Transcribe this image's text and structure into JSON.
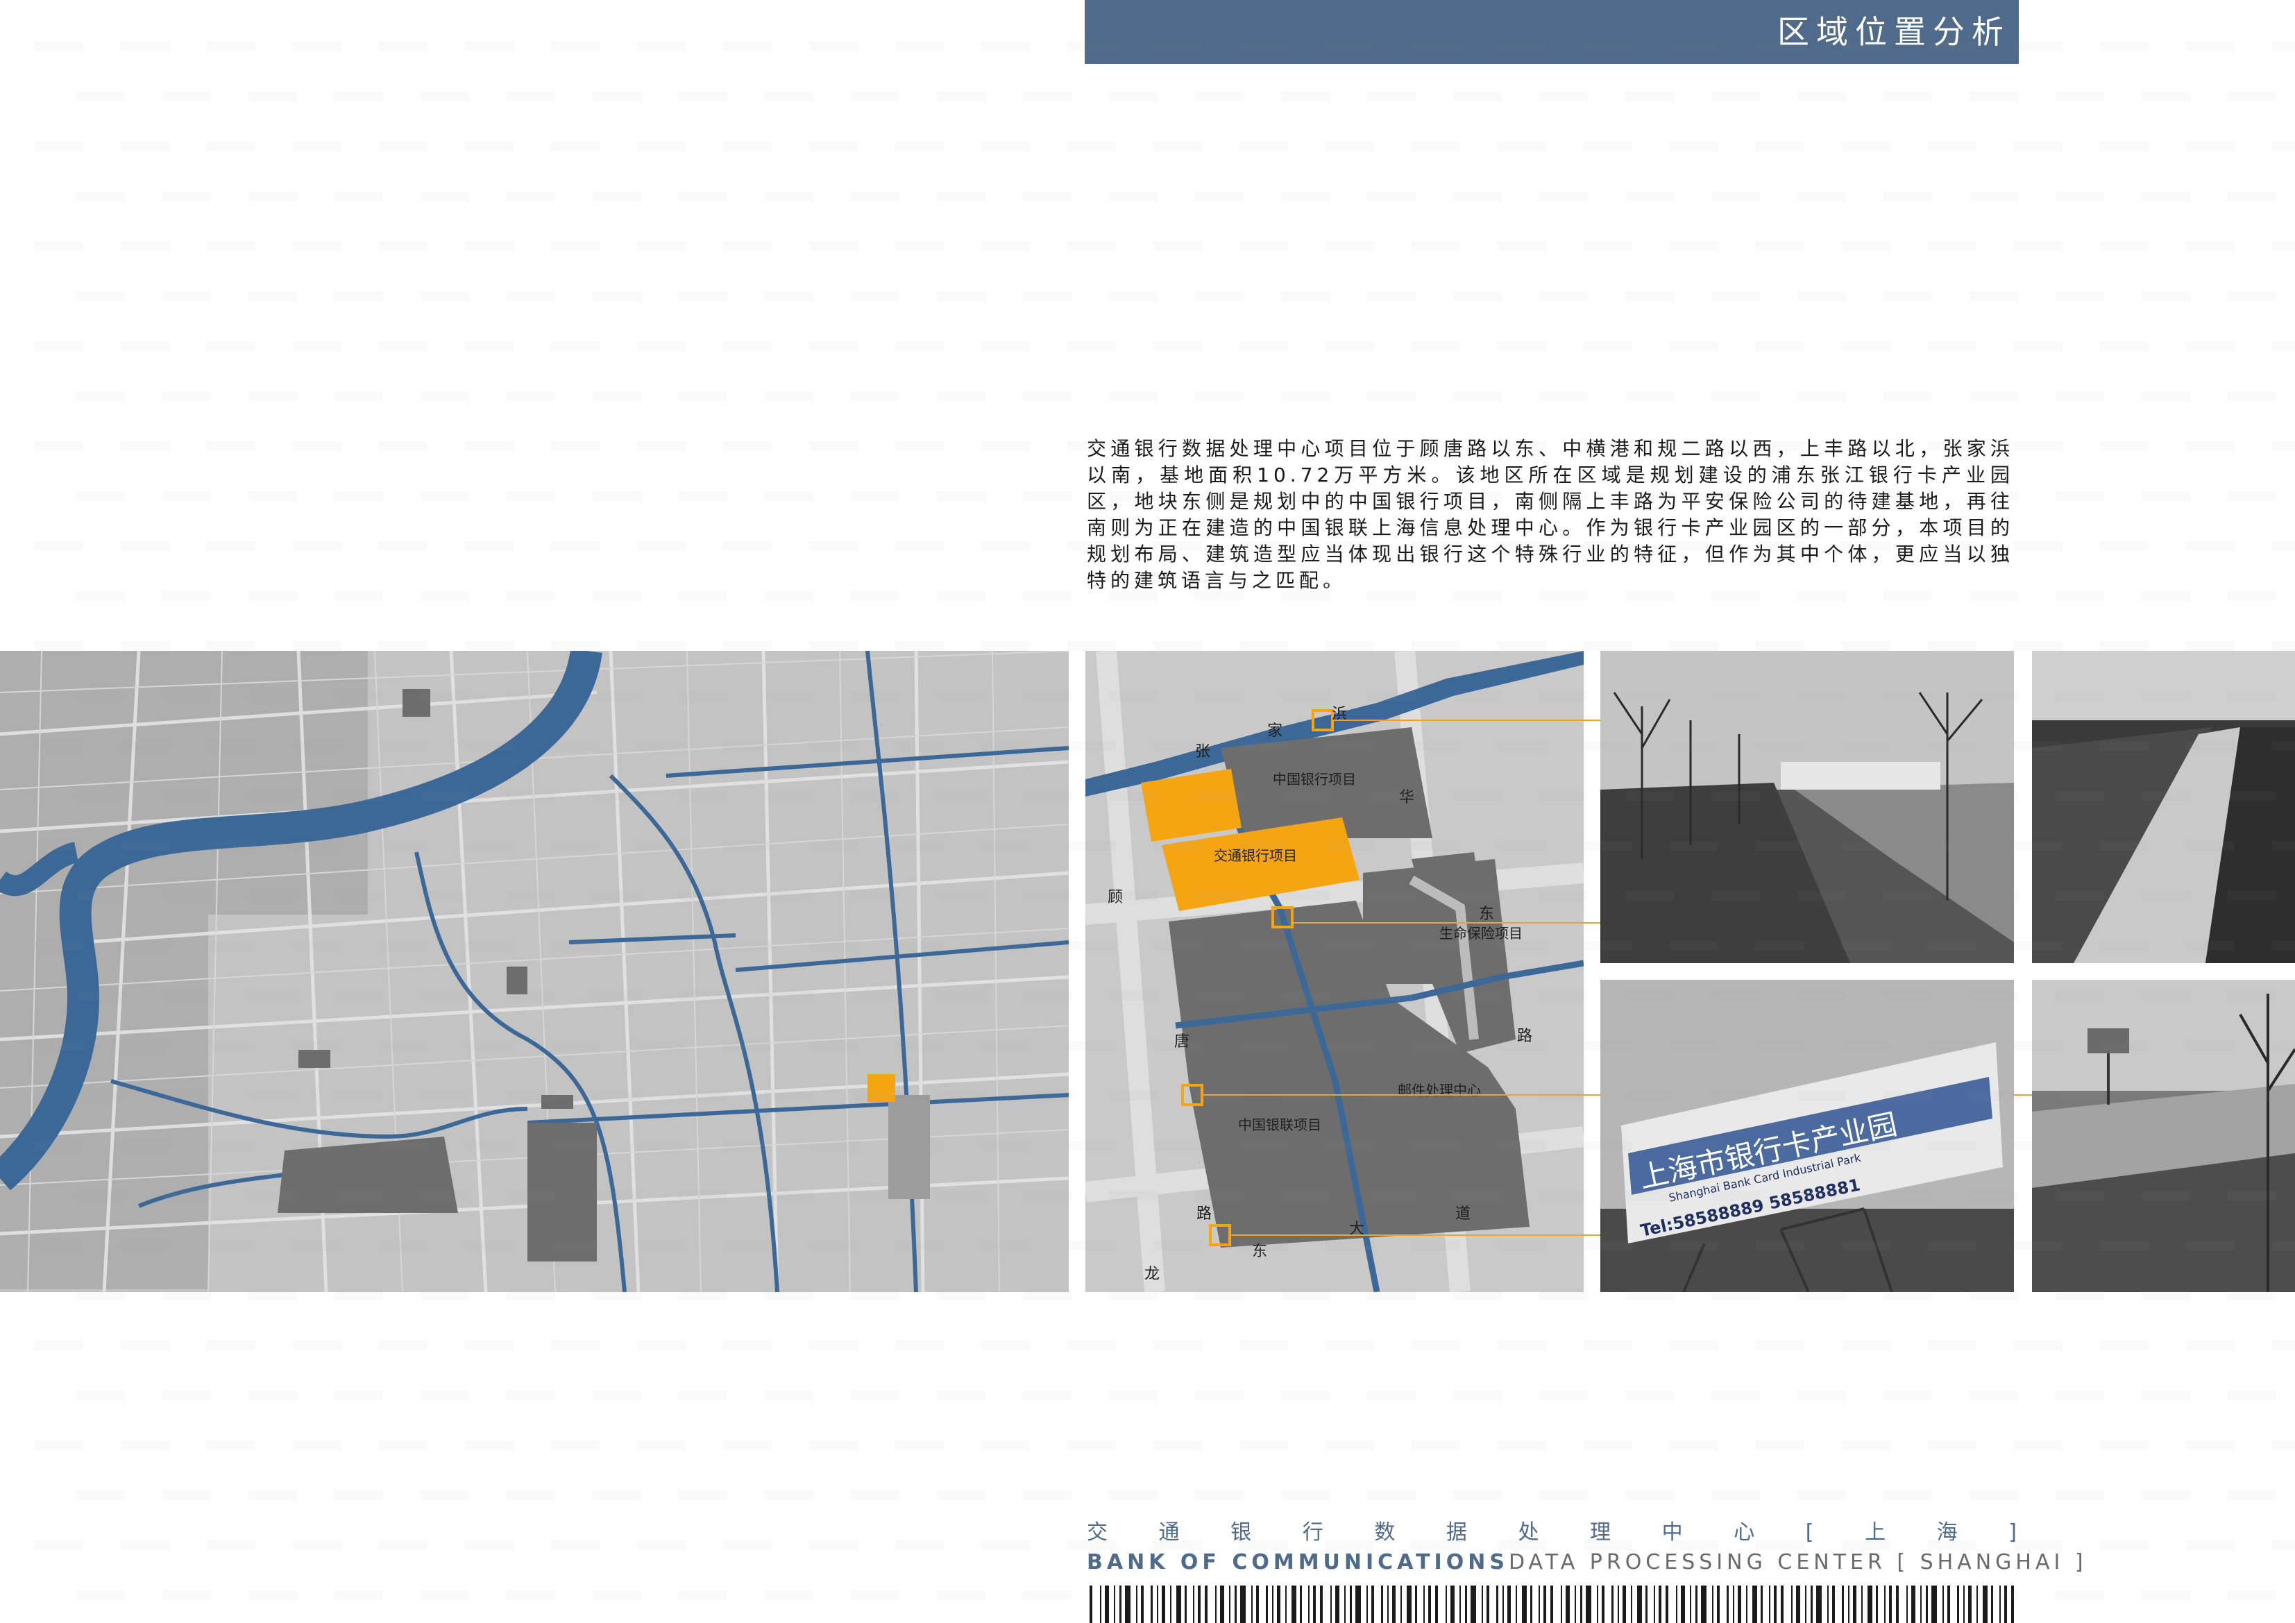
{
  "header": {
    "title": "区域位置分析"
  },
  "description": "交通银行数据处理中心项目位于顾唐路以东、中横港和规二路以西，上丰路以北，张家浜以南，基地面积10.72万平方米。该地区所在区域是规划建设的浦东张江银行卡产业园区，地块东侧是规划中的中国银行项目，南侧隔上丰路为平安保险公司的待建基地，再往南则为正在建造的中国银联上海信息处理中心。作为银行卡产业园区的一部分，本项目的规划布局、建筑造型应当体现出银行这个特殊行业的特征，但作为其中个体，更应当以独特的建筑语言与之匹配。",
  "site_map": {
    "labels": {
      "boc": "中国银行项目",
      "bocom": "交通银行项目",
      "life": "生命保险项目",
      "post": "邮件处理中心",
      "unionpay": "中国银联项目"
    },
    "roads": {
      "zhang": "张",
      "jia": "家",
      "bang": "浜",
      "gu": "顾",
      "tang": "唐",
      "lu_w": "路",
      "hua": "华",
      "dong_e": "东",
      "lu_e": "路",
      "da": "大",
      "dao": "道",
      "long": "龙",
      "dong_s": "东"
    }
  },
  "photos": {
    "billboard_cn": "上海市银行卡产业园",
    "billboard_en": "Shanghai Bank Card Industrial Park",
    "billboard_tel": "Tel:58588889 58588881"
  },
  "footer": {
    "cn_chars": [
      "交",
      "通",
      "银",
      "行",
      "数",
      "据",
      "处",
      "理",
      "中",
      "心",
      "[",
      "上",
      "海",
      "]"
    ],
    "en_bold": "BANK OF COMMUNICATIONS",
    "en_light": "DATA PROCESSING CENTER [ SHANGHAI ]"
  },
  "colors": {
    "accent_blue": "#4f6a8a",
    "site_orange": "#f5a512",
    "river_blue": "#3c6897",
    "block_gray": "#6d6d6d"
  }
}
